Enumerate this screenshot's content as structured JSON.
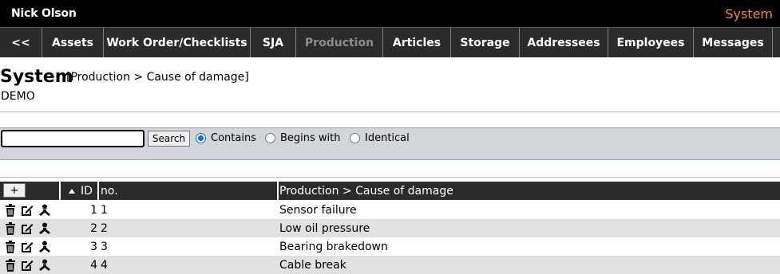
{
  "topbar": {
    "user": "Nick Olson",
    "brand": "System"
  },
  "nav": [
    {
      "label": "<<",
      "active": false
    },
    {
      "label": "Assets",
      "active": false
    },
    {
      "label": "Work Order/Checklists",
      "active": false
    },
    {
      "label": "SJA",
      "active": false
    },
    {
      "label": "Production",
      "active": true
    },
    {
      "label": "Articles",
      "active": false
    },
    {
      "label": "Storage",
      "active": false
    },
    {
      "label": "Addressees",
      "active": false
    },
    {
      "label": "Employees",
      "active": false
    },
    {
      "label": "Messages",
      "active": false
    }
  ],
  "page": {
    "title": "System",
    "breadcrumb": "[Production > Cause of damage]",
    "subtitle": "DEMO"
  },
  "search": {
    "value": "",
    "button": "Search",
    "options": [
      {
        "label": "Contains",
        "checked": true
      },
      {
        "label": "Begins with",
        "checked": false
      },
      {
        "label": "Identical",
        "checked": false
      }
    ]
  },
  "table": {
    "add_label": "+",
    "sort_icon": "sort-up-icon",
    "headers": {
      "id": "ID",
      "no": "no.",
      "desc": "Production > Cause of damage"
    },
    "rows": [
      {
        "id": "1",
        "no": "1",
        "desc": "Sensor failure"
      },
      {
        "id": "2",
        "no": "2",
        "desc": "Low oil pressure"
      },
      {
        "id": "3",
        "no": "3",
        "desc": "Bearing brakedown"
      },
      {
        "id": "4",
        "no": "4",
        "desc": "Cable break"
      }
    ]
  },
  "colors": {
    "accent": "#f28c28",
    "nav_bg": "#2b2b2b",
    "search_bg": "#d2d5d9",
    "row_alt": "#e1e1e1"
  }
}
